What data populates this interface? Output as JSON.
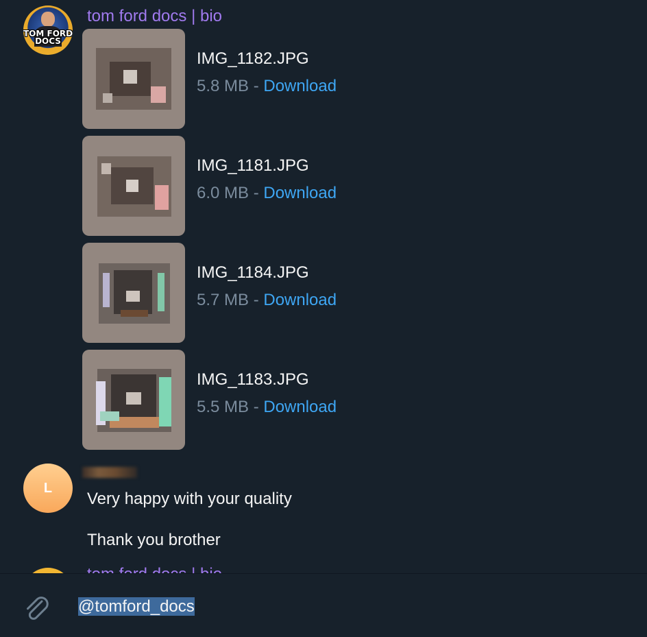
{
  "sender": {
    "name": "tom ford docs | bio",
    "avatar_text": "TOM FORD\nDOCS"
  },
  "files": [
    {
      "name": "IMG_1182.JPG",
      "size": "5.8 MB",
      "separator": " - ",
      "action": "Download"
    },
    {
      "name": "IMG_1181.JPG",
      "size": "6.0 MB",
      "separator": " - ",
      "action": "Download"
    },
    {
      "name": "IMG_1184.JPG",
      "size": "5.7 MB",
      "separator": " - ",
      "action": "Download"
    },
    {
      "name": "IMG_1183.JPG",
      "size": "5.5 MB",
      "separator": " - ",
      "action": "Download"
    }
  ],
  "reply": {
    "avatar_letter": "L",
    "lines": [
      "Very happy with your quality",
      "Thank you brother"
    ]
  },
  "composer": {
    "text": "@tomford_docs"
  },
  "colors": {
    "background": "#17212b",
    "sender_name": "#a07aee",
    "link": "#3ea6f3",
    "meta": "#7b8c9d",
    "text": "#f5f5f5",
    "selection": "#3e6a9c"
  }
}
